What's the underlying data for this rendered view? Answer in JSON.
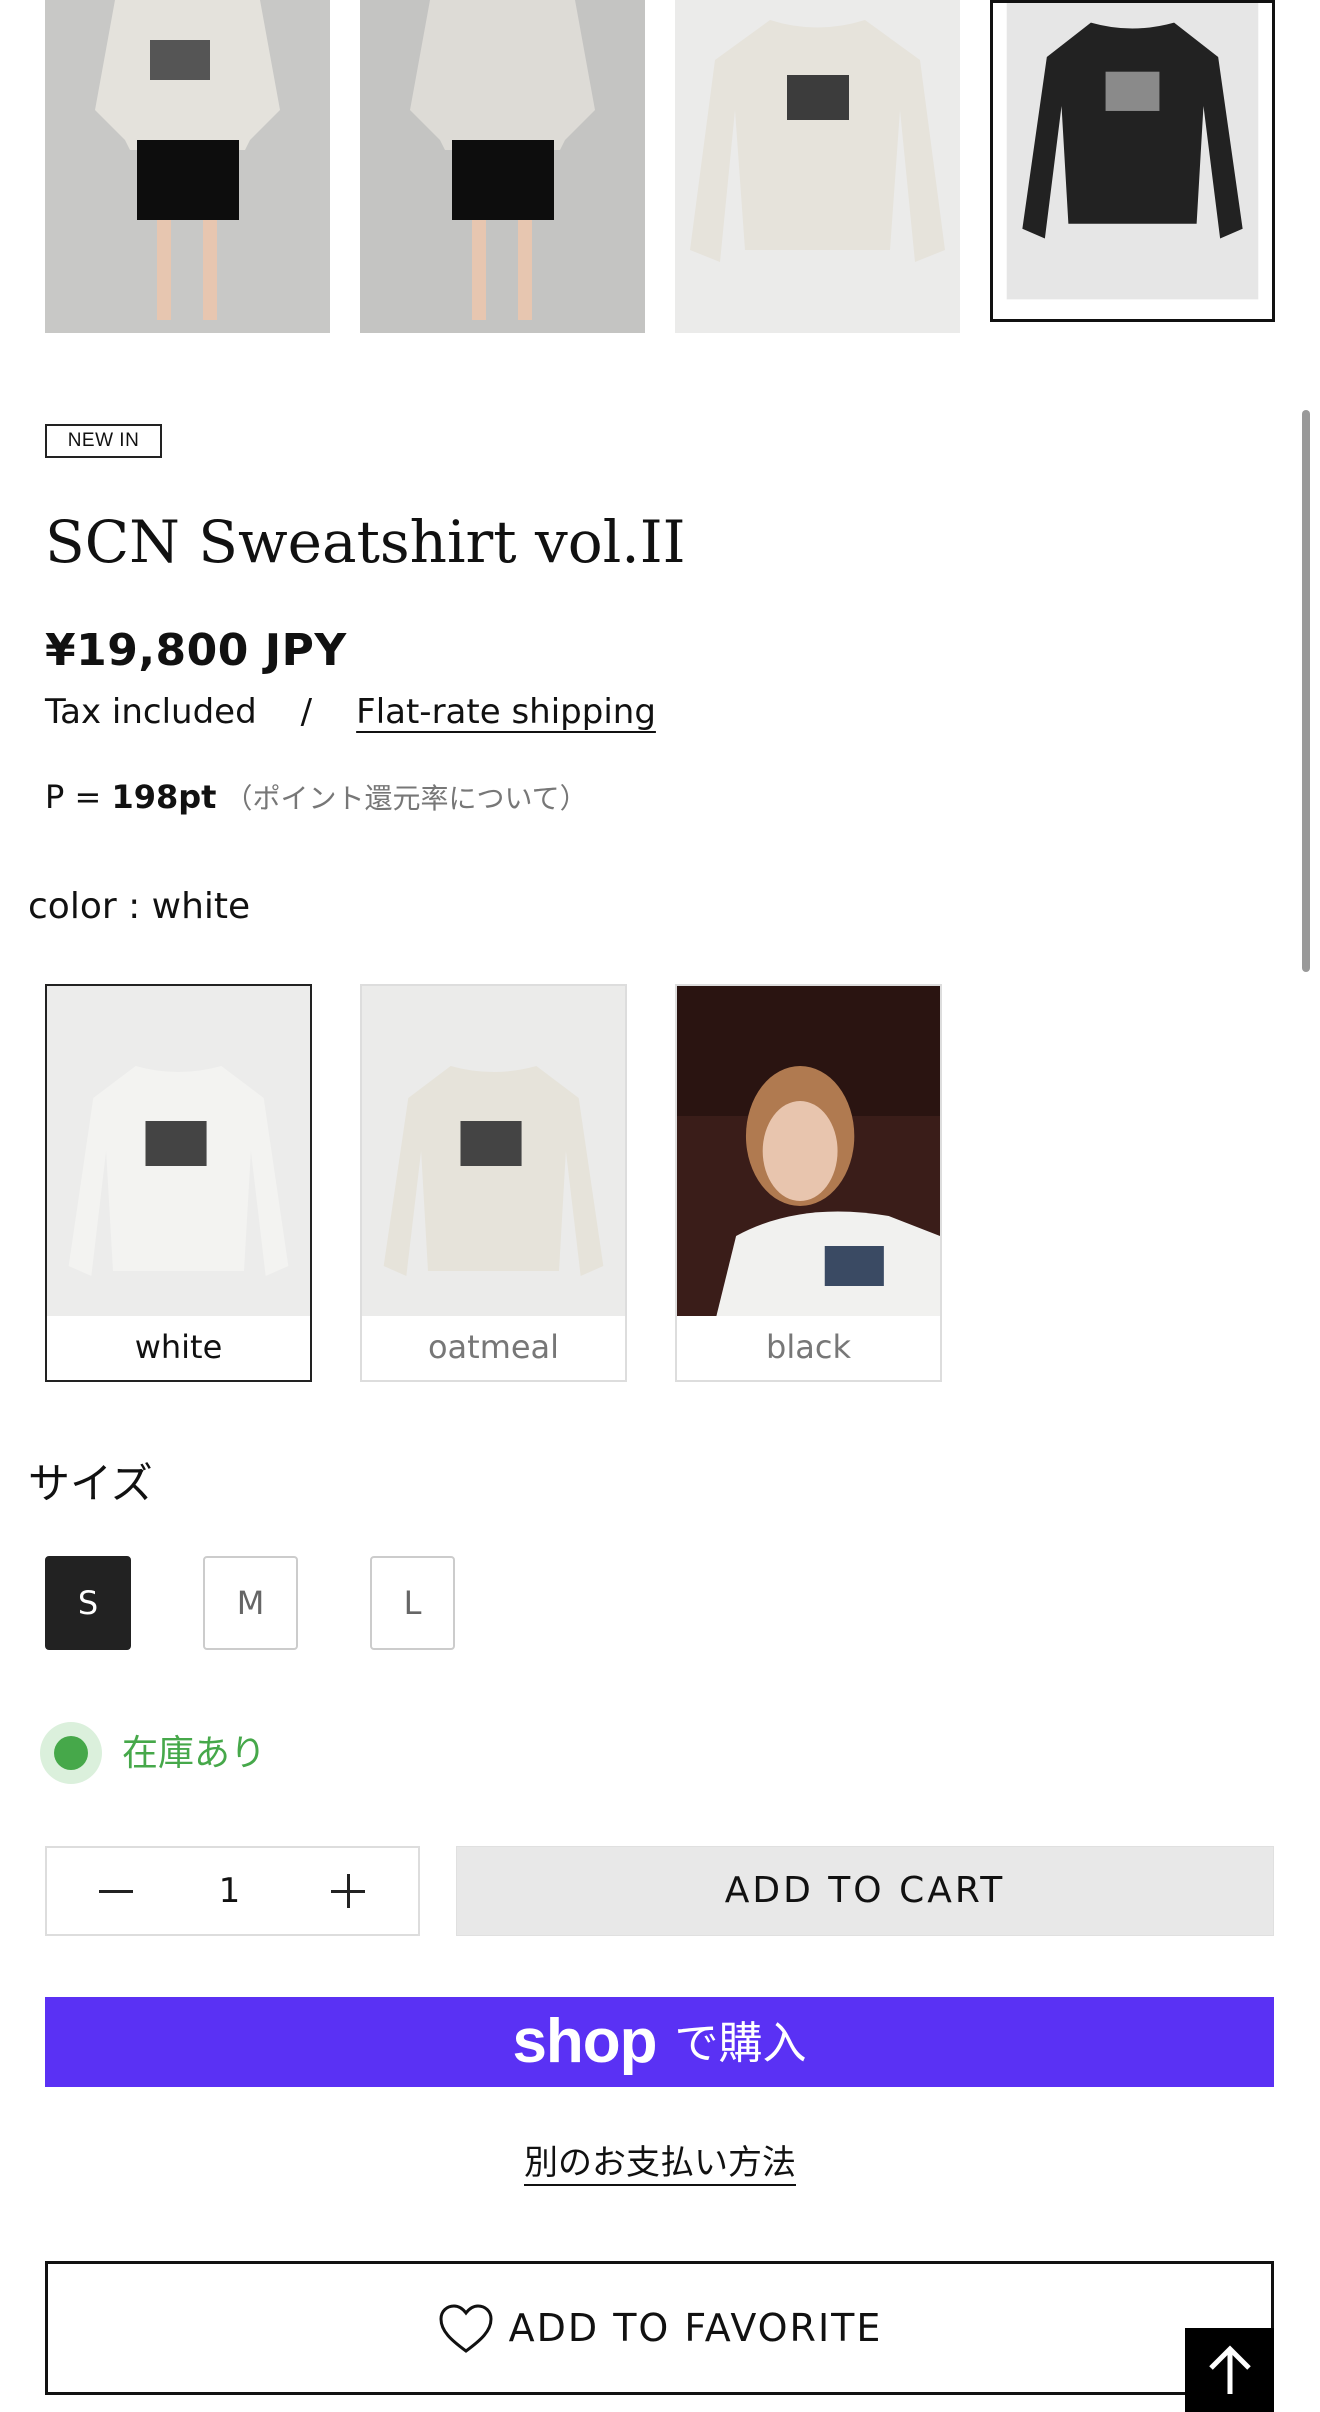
{
  "gallery": {
    "thumbnails": [
      {
        "name": "model-front-photo"
      },
      {
        "name": "model-back-photo"
      },
      {
        "name": "oatmeal-flat-photo"
      },
      {
        "name": "black-flat-photo",
        "selected": true
      }
    ]
  },
  "product": {
    "badge": "NEW IN",
    "title": "SCN Sweatshirt vol.II",
    "price": "¥19,800 JPY",
    "tax_label": "Tax included",
    "separator": "/",
    "shipping_link": "Flat-rate shipping",
    "points_prefix": "P = ",
    "points_value": "198pt",
    "points_note": "（ポイント還元率について）"
  },
  "color": {
    "label": "color : white",
    "options": [
      {
        "label": "white",
        "selected": true
      },
      {
        "label": "oatmeal",
        "selected": false
      },
      {
        "label": "black",
        "selected": false
      }
    ]
  },
  "size": {
    "label": "サイズ",
    "options": [
      {
        "label": "S",
        "selected": true
      },
      {
        "label": "M",
        "selected": false
      },
      {
        "label": "L",
        "selected": false
      }
    ]
  },
  "stock": {
    "text": "在庫あり",
    "color": "#46a84a"
  },
  "purchase": {
    "quantity": "1",
    "add_to_cart": "ADD TO CART",
    "shop_pay_word": "shop",
    "shop_pay_suffix": "で購入",
    "shop_pay_color": "#5a31f4",
    "other_payment": "別のお支払い方法",
    "add_to_favorite": "ADD TO FAVORITE"
  },
  "icons": {
    "minus": "minus-icon",
    "plus": "plus-icon",
    "heart": "heart-icon",
    "back_to_top": "arrow-up-icon"
  }
}
